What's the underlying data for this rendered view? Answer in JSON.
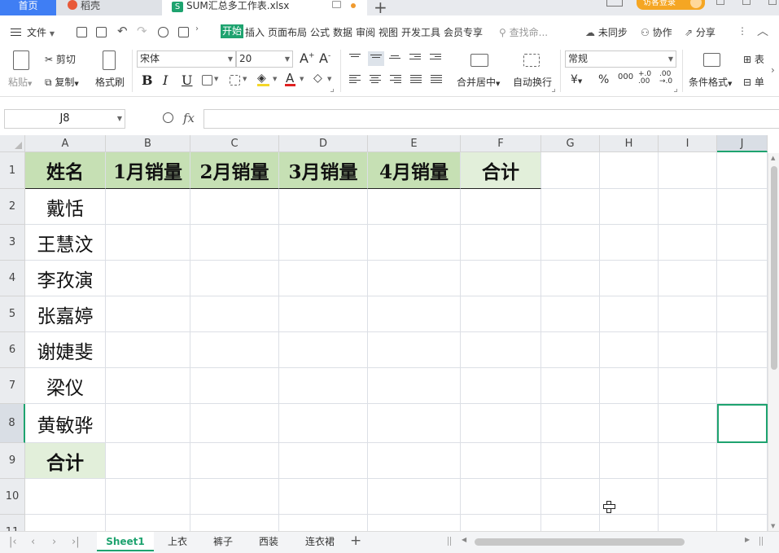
{
  "tabs": {
    "home": "首页",
    "daoke": "稻壳",
    "file": "SUM汇总多工作表.xlsx",
    "file_icon_letter": "S",
    "login": "访客登录"
  },
  "menu": {
    "file": "文件",
    "items": [
      "开始",
      "插入",
      "页面布局",
      "公式",
      "数据",
      "审阅",
      "视图",
      "开发工具",
      "会员专享"
    ],
    "search": "查找命...",
    "unsync": "未同步",
    "collab": "协作",
    "share": "分享"
  },
  "ribbon": {
    "paste": "粘贴",
    "cut": "剪切",
    "copy": "复制",
    "format_painter": "格式刷",
    "font_name": "宋体",
    "font_size": "20",
    "bold": "B",
    "italic": "I",
    "underline": "U",
    "merge": "合并居中",
    "wrap": "自动换行",
    "number_format": "常规",
    "currency": "¥",
    "percent": "%",
    "thousands": "000",
    "inc_decimal": "+.0\n.00",
    "dec_decimal": ".00\n→.0",
    "cond_format": "条件格式",
    "table_style": "表",
    "cell_style": "单"
  },
  "formula": {
    "cell_ref": "J8",
    "fx": "fx",
    "value": ""
  },
  "grid": {
    "columns": [
      "A",
      "B",
      "C",
      "D",
      "E",
      "F",
      "G",
      "H",
      "I",
      "J"
    ],
    "rows": [
      "1",
      "2",
      "3",
      "4",
      "5",
      "6",
      "7",
      "8",
      "9",
      "10",
      "11"
    ],
    "headers": [
      "姓名",
      "1月销量",
      "2月销量",
      "3月销量",
      "4月销量",
      "合计"
    ],
    "names": [
      "戴恬",
      "王慧汶",
      "李孜演",
      "张嘉婷",
      "谢婕斐",
      "梁仪",
      "黄敏骅"
    ],
    "total_label": "合计"
  },
  "sheets": [
    "Sheet1",
    "上衣",
    "裤子",
    "西装",
    "连衣裙"
  ],
  "colors": {
    "accent_green": "#1ea36f",
    "header_fill": "#c6e0b4",
    "header_light_fill": "#e2efda",
    "home_tab": "#3f7ef4"
  }
}
